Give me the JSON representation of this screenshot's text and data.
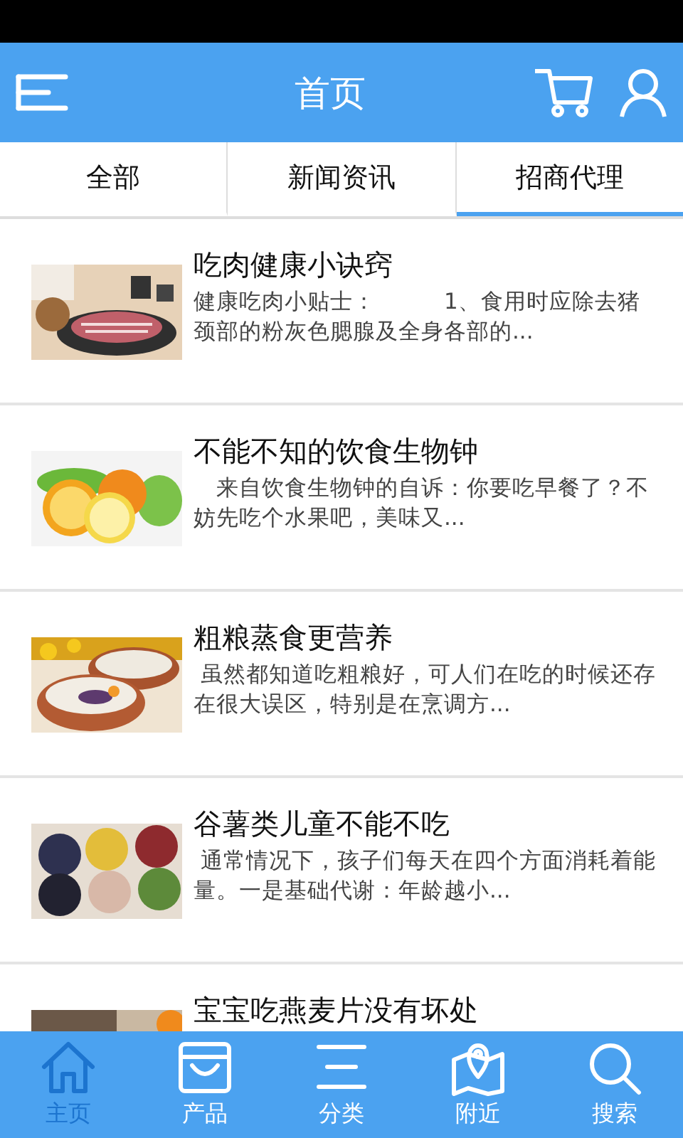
{
  "header": {
    "title": "首页"
  },
  "tabs": [
    {
      "label": "全部",
      "selected": false
    },
    {
      "label": "新闻资讯",
      "selected": false
    },
    {
      "label": "招商代理",
      "selected": true
    }
  ],
  "articles": [
    {
      "title": "吃肉健康小诀窍",
      "snippet": "健康吃肉小贴士：　　　1、食用时应除去猪颈部的粉灰色腮腺及全身各部的..."
    },
    {
      "title": "不能不知的饮食生物钟",
      "snippet": "　来自饮食生物钟的自诉：你要吃早餐了？不妨先吃个水果吧，美味又..."
    },
    {
      "title": "粗粮蒸食更营养",
      "snippet": " 虽然都知道吃粗粮好，可人们在吃的时候还存在很大误区，特别是在烹调方..."
    },
    {
      "title": "谷薯类儿童不能不吃",
      "snippet": " 通常情况下，孩子们每天在四个方面消耗着能量。一是基础代谢：年龄越小..."
    },
    {
      "title": "宝宝吃燕麦片没有坏处"
    }
  ],
  "bottom_nav": [
    {
      "label": "主页",
      "kind": "home",
      "selected": true
    },
    {
      "label": "产品",
      "kind": "bag",
      "selected": false
    },
    {
      "label": "分类",
      "kind": "list",
      "selected": false
    },
    {
      "label": "附近",
      "kind": "map",
      "selected": false
    },
    {
      "label": "搜索",
      "kind": "search",
      "selected": false
    }
  ]
}
